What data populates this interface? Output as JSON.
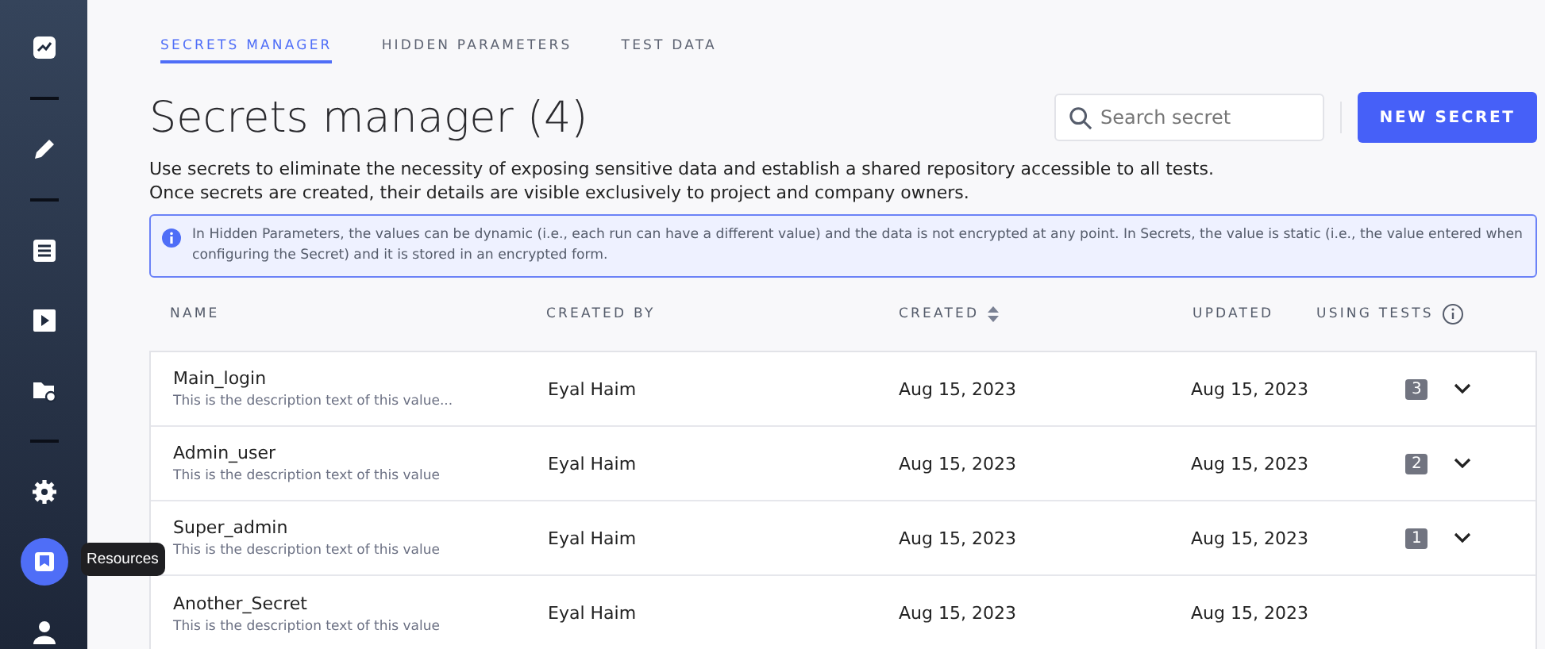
{
  "sidebar": {
    "items": [
      {
        "kind": "icon",
        "selected": false
      },
      {
        "kind": "divider"
      },
      {
        "kind": "icon",
        "selected": false
      },
      {
        "kind": "divider"
      },
      {
        "kind": "icon",
        "selected": false
      },
      {
        "kind": "icon",
        "selected": false
      },
      {
        "kind": "icon",
        "selected": false
      },
      {
        "kind": "divider"
      },
      {
        "kind": "icon",
        "selected": false
      },
      {
        "kind": "icon",
        "selected": true
      },
      {
        "kind": "icon",
        "selected": false
      }
    ],
    "tooltip": "Resources"
  },
  "tabs": [
    {
      "label": "SECRETS MANAGER",
      "selected": true
    },
    {
      "label": "HIDDEN PARAMETERS",
      "selected": false
    },
    {
      "label": "TEST DATA",
      "selected": false
    }
  ],
  "title": "Secrets manager (4)",
  "search": {
    "placeholder": "Search secret"
  },
  "new_button": "NEW SECRET",
  "description": [
    "Use secrets to eliminate the necessity of exposing sensitive data and establish a shared repository accessible to all tests.",
    "Once secrets are created, their details are visible exclusively to project and company owners."
  ],
  "info": "In Hidden Parameters, the values can be dynamic (i.e., each run can have a different value) and the data is not encrypted at any point. In Secrets, the value is static (i.e., the value entered when configuring the Secret) and it is stored in an encrypted form.",
  "table": {
    "columns": [
      {
        "label": "NAME",
        "sortable": false,
        "info": false
      },
      {
        "label": "CREATED BY",
        "sortable": false,
        "info": false
      },
      {
        "label": "CREATED",
        "sortable": true,
        "info": false
      },
      {
        "label": "UPDATED",
        "sortable": false,
        "info": false
      },
      {
        "label": "USING TESTS",
        "sortable": false,
        "info": true
      }
    ],
    "rows": [
      {
        "name": "Main_login",
        "description": "This is the description text of this value...",
        "created_by": "Eyal Haim",
        "created": "Aug 15, 2023",
        "updated": "Aug 15, 2023",
        "using_tests": "3"
      },
      {
        "name": "Admin_user",
        "description": "This is the description text of this value",
        "created_by": "Eyal Haim",
        "created": "Aug 15, 2023",
        "updated": "Aug 15, 2023",
        "using_tests": "2"
      },
      {
        "name": "Super_admin",
        "description": "This is the description text of this value",
        "created_by": "Eyal Haim",
        "created": "Aug 15, 2023",
        "updated": "Aug 15, 2023",
        "using_tests": "1"
      },
      {
        "name": "Another_Secret",
        "description": "This is the description text of this value",
        "created_by": "Eyal Haim",
        "created": "Aug 15, 2023",
        "updated": "Aug 15, 2023"
      }
    ]
  }
}
